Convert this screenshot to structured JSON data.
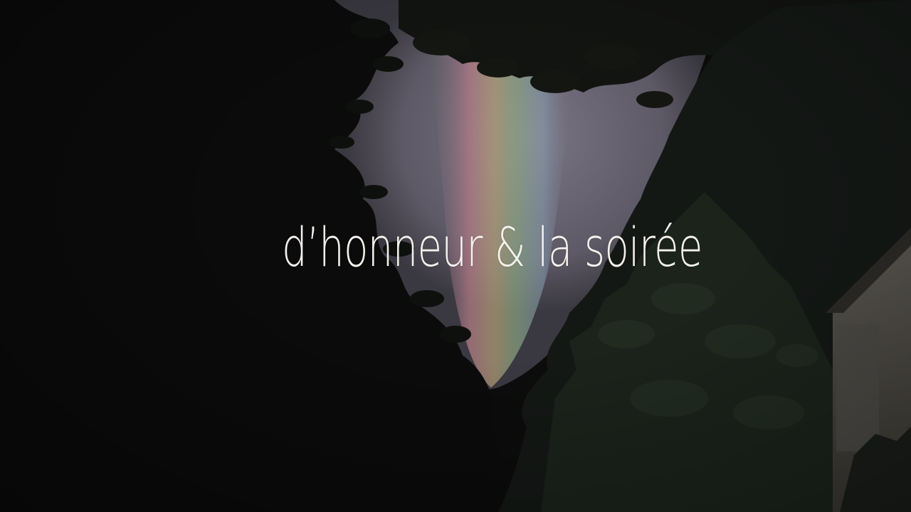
{
  "caption": {
    "text": "d’honneur & la soirée",
    "color": "#f4f1ec"
  },
  "scene": {
    "background_color": "#0b0c0b",
    "sky_color": "#6e6a76",
    "rainbow_colors": [
      "#b27a86",
      "#b8a27a",
      "#8fae86",
      "#8aa0b4"
    ]
  }
}
